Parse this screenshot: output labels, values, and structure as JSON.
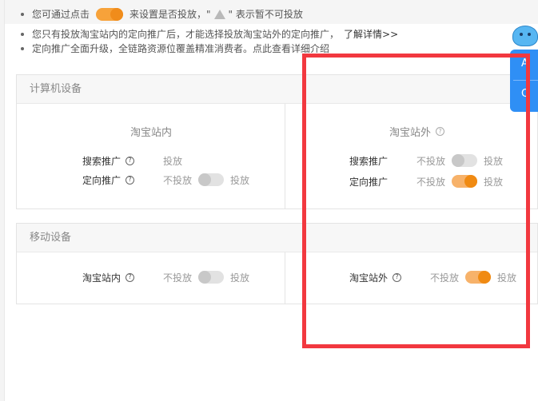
{
  "notices": {
    "line1_pre": "您可通过点击",
    "line1_mid": "来设置是否投放，\"",
    "line1_post": "\" 表示暂不可投放",
    "line2": "您只有投放淘宝站内的定向推广后，才能选择投放淘宝站外的定向推广，",
    "line2_link": "了解详情>>",
    "line3": "定向推广全面升级，全链路资源位覆盖精准消费者。点此查看详细介绍"
  },
  "pc_panel": {
    "title": "计算机设备",
    "inside": {
      "title": "淘宝站内",
      "rows": [
        {
          "label": "搜索推广",
          "on_label": "投放"
        },
        {
          "label": "定向推广",
          "off_label": "不投放",
          "on_label": "投放",
          "state": "off"
        }
      ]
    },
    "outside": {
      "title": "淘宝站外",
      "rows": [
        {
          "label": "搜索推广",
          "off_label": "不投放",
          "on_label": "投放",
          "state": "off"
        },
        {
          "label": "定向推广",
          "off_label": "不投放",
          "on_label": "投放",
          "state": "on"
        }
      ]
    }
  },
  "mobile_panel": {
    "title": "移动设备",
    "inside": {
      "label": "淘宝站内",
      "off_label": "不投放",
      "on_label": "投放",
      "state": "off"
    },
    "outside": {
      "label": "淘宝站外",
      "off_label": "不投放",
      "on_label": "投放",
      "state": "on"
    }
  },
  "float_widget": {
    "glyph1": "A",
    "glyph2": "Q"
  },
  "help_mark": "?",
  "colors": {
    "accent_orange": "#f08a12",
    "highlight_red": "#f2383f",
    "widget_blue": "#2f8ff5"
  }
}
